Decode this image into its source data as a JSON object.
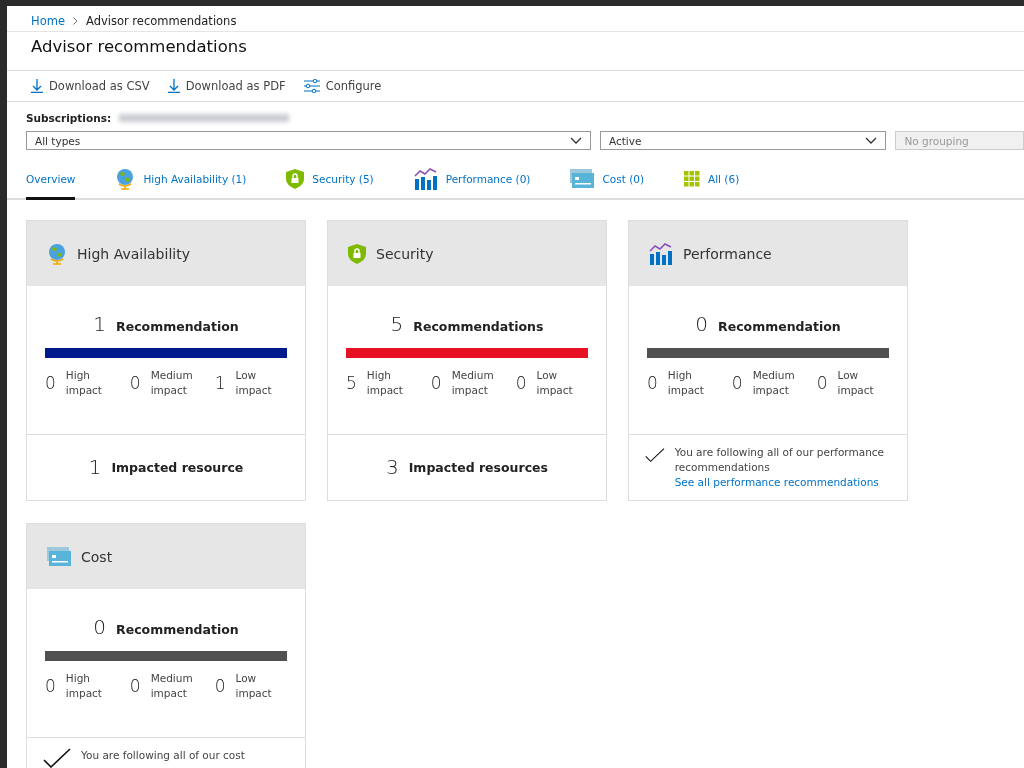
{
  "breadcrumb": [
    {
      "label": "Home",
      "link": true
    },
    {
      "label": "Advisor recommendations",
      "link": false
    }
  ],
  "title": "Advisor recommendations",
  "toolbar": [
    {
      "label": "Download as CSV",
      "kind": "download"
    },
    {
      "label": "Download as PDF",
      "kind": "download"
    },
    {
      "label": "Configure",
      "kind": "configure"
    }
  ],
  "subscriptions": {
    "label": "Subscriptions:"
  },
  "filters": [
    {
      "value": "All types",
      "disabled": false
    },
    {
      "value": "Active",
      "disabled": false
    },
    {
      "value": "No grouping",
      "disabled": true
    }
  ],
  "tabs": [
    {
      "label": "Overview",
      "kind": "overview",
      "selected": true
    },
    {
      "label": "High Availability (1)",
      "kind": "availability",
      "selected": false
    },
    {
      "label": "Security (5)",
      "kind": "security",
      "selected": false
    },
    {
      "label": "Performance (0)",
      "kind": "performance",
      "selected": false
    },
    {
      "label": "Cost (0)",
      "kind": "cost",
      "selected": false
    },
    {
      "label": "All (6)",
      "kind": "all",
      "selected": false
    }
  ],
  "cards": [
    {
      "title": "High Availability",
      "kind": "availability",
      "count": "1",
      "unit": "Recommendation",
      "color": "#001a8c",
      "impacts": [
        {
          "count": "0",
          "label": "High impact"
        },
        {
          "count": "0",
          "label": "Medium impact"
        },
        {
          "count": "1",
          "label": "Low impact"
        }
      ],
      "footer": {
        "kind": "resources",
        "count": "1",
        "label": "Impacted resource"
      }
    },
    {
      "title": "Security",
      "kind": "security",
      "count": "5",
      "unit": "Recommendations",
      "color": "#e81123",
      "impacts": [
        {
          "count": "5",
          "label": "High impact"
        },
        {
          "count": "0",
          "label": "Medium impact"
        },
        {
          "count": "0",
          "label": "Low impact"
        }
      ],
      "footer": {
        "kind": "resources",
        "count": "3",
        "label": "Impacted resources"
      }
    },
    {
      "title": "Performance",
      "kind": "performance",
      "count": "0",
      "unit": "Recommendation",
      "color": "#505050",
      "impacts": [
        {
          "count": "0",
          "label": "High impact"
        },
        {
          "count": "0",
          "label": "Medium impact"
        },
        {
          "count": "0",
          "label": "Low impact"
        }
      ],
      "footer": {
        "kind": "following",
        "message": "You are following all of our performance recommendations",
        "link": "See all performance recommendations"
      }
    },
    {
      "title": "Cost",
      "kind": "cost",
      "count": "0",
      "unit": "Recommendation",
      "color": "#505050",
      "impacts": [
        {
          "count": "0",
          "label": "High impact"
        },
        {
          "count": "0",
          "label": "Medium impact"
        },
        {
          "count": "0",
          "label": "Low impact"
        }
      ],
      "footer": {
        "kind": "following",
        "message": "You are following all of our cost"
      }
    }
  ]
}
